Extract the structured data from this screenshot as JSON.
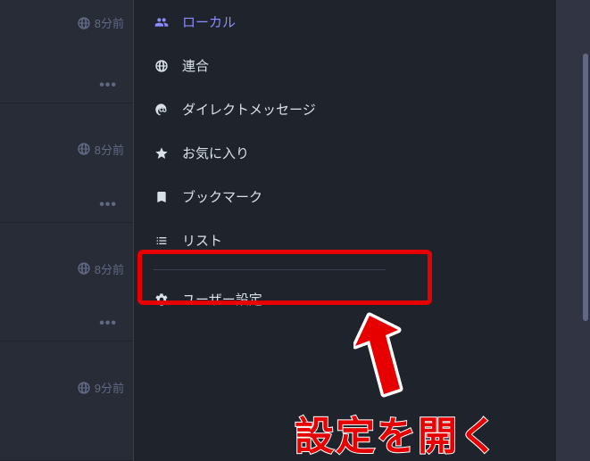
{
  "feed": {
    "items": [
      {
        "time": "8分前",
        "show_ellipsis": true,
        "first": true
      },
      {
        "time": "8分前",
        "show_ellipsis": true
      },
      {
        "time": "8分前",
        "show_ellipsis": true
      },
      {
        "time": "9分前",
        "show_ellipsis": false
      }
    ]
  },
  "nav": {
    "local": {
      "label": "ローカル"
    },
    "federated": {
      "label": "連合"
    },
    "direct": {
      "label": "ダイレクトメッセージ"
    },
    "favourites": {
      "label": "お気に入り"
    },
    "bookmarks": {
      "label": "ブックマーク"
    },
    "lists": {
      "label": "リスト"
    },
    "settings": {
      "label": "ユーザー設定"
    }
  },
  "annotation": {
    "text": "設定を開く"
  },
  "colors": {
    "accent_active": "#8c8dff",
    "highlight": "#e60000"
  }
}
